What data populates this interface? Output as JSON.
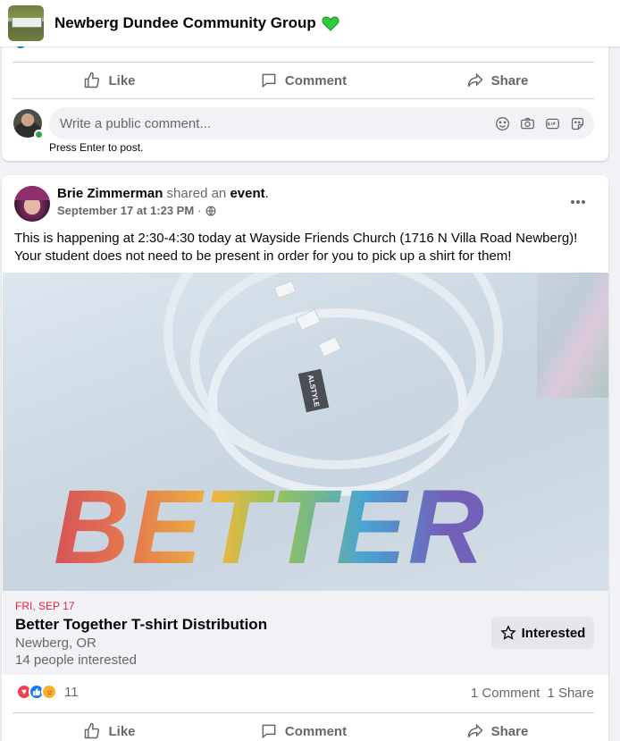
{
  "header": {
    "group_name": "Newberg Dundee Community Group",
    "accent_heart_color": "#2ecc3c"
  },
  "previous_post": {
    "actions": {
      "like": "Like",
      "comment": "Comment",
      "share": "Share"
    },
    "comment_placeholder": "Write a public comment...",
    "comment_icons": [
      "emoji-icon",
      "camera-icon",
      "gif-icon",
      "sticker-icon"
    ],
    "press_enter": "Press Enter to post."
  },
  "post": {
    "author": "Brie Zimmerman",
    "shared_text": "shared an",
    "shared_object": "event",
    "period": ".",
    "timestamp": "September 17 at 1:23 PM",
    "separator": "·",
    "privacy_icon": "globe-icon",
    "body": "This is happening at 2:30-4:30 today at Wayside Friends Church (1716 N Villa Road Newberg)! Your student does not need to be present in order for you to pick up a shirt for them!",
    "photo_text": "BETTER",
    "tag_text": "ALSTYLE",
    "event": {
      "date": "FRI, SEP 17",
      "title": "Better Together T-shirt Distribution",
      "location": "Newberg, OR",
      "interested_count": "14 people interested",
      "interested_button": "Interested"
    },
    "reactions": {
      "types": [
        "love",
        "like",
        "care"
      ],
      "count": "11"
    },
    "engagement": {
      "comments": "1 Comment",
      "shares": "1 Share"
    },
    "actions": {
      "like": "Like",
      "comment": "Comment",
      "share": "Share"
    }
  }
}
